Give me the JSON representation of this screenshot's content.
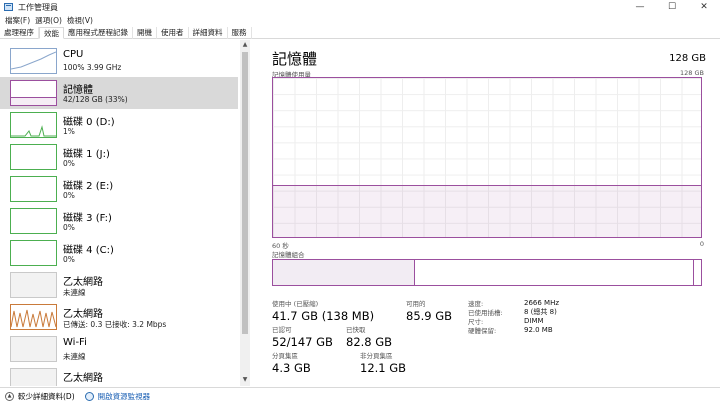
{
  "window": {
    "title": "工作管理員",
    "minimize": "—",
    "maximize": "☐",
    "close": "✕"
  },
  "menu": [
    "檔案(F)",
    "選項(O)",
    "檢視(V)"
  ],
  "tabs": [
    "處理程序",
    "效能",
    "應用程式歷程記錄",
    "開機",
    "使用者",
    "詳細資料",
    "服務"
  ],
  "active_tab": "效能",
  "sidebar": {
    "items": [
      {
        "name": "CPU",
        "sub": "100% 3.99 GHz"
      },
      {
        "name": "記憶體",
        "sub": "42/128 GB (33%)"
      },
      {
        "name": "磁碟 0 (D:)",
        "sub": "1%"
      },
      {
        "name": "磁碟 1 (J:)",
        "sub": "0%"
      },
      {
        "name": "磁碟 2 (E:)",
        "sub": "0%"
      },
      {
        "name": "磁碟 3 (F:)",
        "sub": "0%"
      },
      {
        "name": "磁碟 4 (C:)",
        "sub": "0%"
      },
      {
        "name": "乙太網路",
        "sub": "未連線"
      },
      {
        "name": "乙太網路",
        "sub": "已傳送: 0.3  已接收: 3.2 Mbps"
      },
      {
        "name": "Wi-Fi",
        "sub": "未連線"
      },
      {
        "name": "乙太網路",
        "sub": ""
      }
    ]
  },
  "memory": {
    "title": "記憶體",
    "total": "128 GB",
    "graph_label": "記憶體使用量",
    "graph_max": "128 GB",
    "graph_time": "60 秒",
    "graph_min": "0",
    "composition_label": "記憶體組合",
    "usage_fraction": 0.33,
    "stats": {
      "in_use_label": "使用中 (已壓縮)",
      "in_use_value": "41.7 GB (138 MB)",
      "available_label": "可用的",
      "available_value": "85.9 GB",
      "committed_label": "已認可",
      "committed_value": "52/147 GB",
      "cached_label": "已快取",
      "cached_value": "82.8 GB",
      "paged_label": "分頁集區",
      "paged_value": "4.3 GB",
      "nonpaged_label": "非分頁集區",
      "nonpaged_value": "12.1 GB"
    },
    "specs": [
      {
        "key": "速度:",
        "value": "2666 MHz"
      },
      {
        "key": "已使用插槽:",
        "value": "8 (總共 8)"
      },
      {
        "key": "尺寸:",
        "value": "DIMM"
      },
      {
        "key": "硬體保留:",
        "value": "92.0 MB"
      }
    ]
  },
  "footer": {
    "less_details": "較少詳細資料(D)",
    "resource_monitor": "開啟資源監視器"
  },
  "colors": {
    "memory": "#9b4f9e",
    "cpu": "#8aa6cc",
    "disk": "#4caf50",
    "selected": "#d9d9d9"
  }
}
